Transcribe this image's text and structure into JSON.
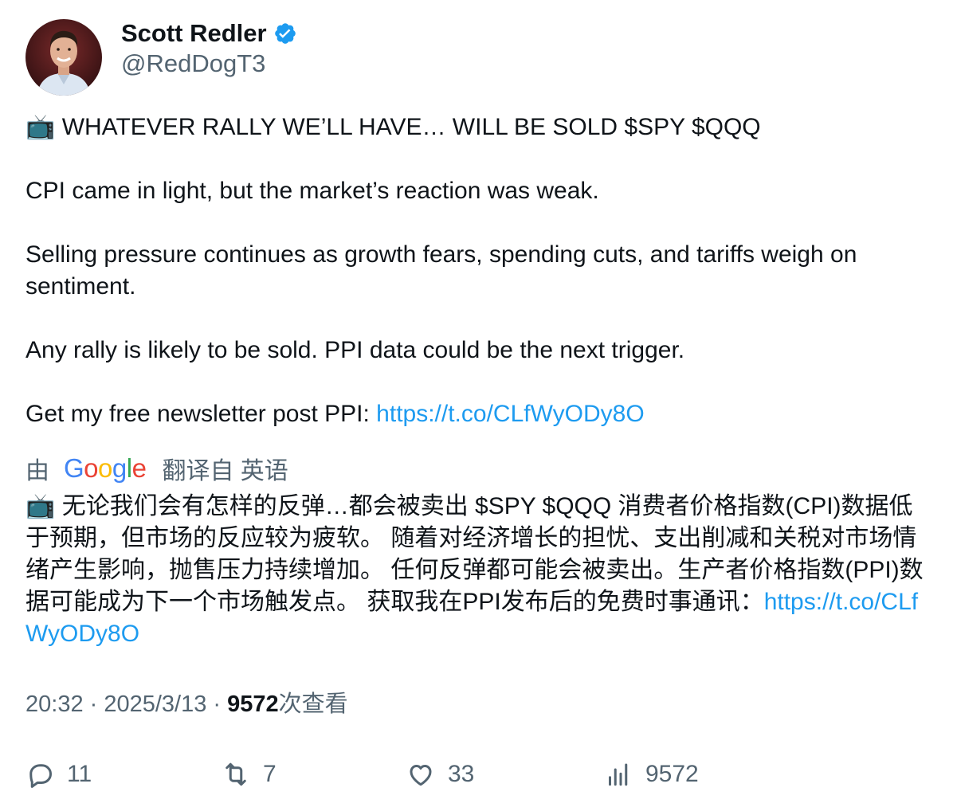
{
  "author": {
    "display_name": "Scott Redler",
    "handle": "@RedDogT3",
    "verified": true,
    "verified_color": "#1d9bf0"
  },
  "tweet": {
    "line1": "📺 WHATEVER RALLY WE’LL HAVE… WILL BE SOLD $SPY $QQQ",
    "line2": "CPI came in light, but the market’s reaction was weak.",
    "line3": "Selling pressure continues as growth fears, spending cuts, and tariffs weigh on sentiment.",
    "line4": "Any rally is likely to be sold. PPI data could be the next trigger.",
    "line5_prefix": "Get my free newsletter post PPI: ",
    "link": "https://t.co/CLfWyODy8O"
  },
  "translation": {
    "by_label": "由",
    "google_letters": [
      "G",
      "o",
      "o",
      "g",
      "l",
      "e"
    ],
    "translated_from": "翻译自 英语",
    "text": "📺 无论我们会有怎样的反弹…都会被卖出 $SPY $QQQ 消费者价格指数(CPI)数据低于预期，但市场的反应较为疲软。 随着对经济增长的担忧、支出削减和关税对市场情绪产生影响，抛售压力持续增加。 任何反弹都可能会被卖出。生产者价格指数(PPI)数据可能成为下一个市场触发点。 获取我在PPI发布后的免费时事通讯：",
    "link": "https://t.co/CLfWyODy8O"
  },
  "meta": {
    "time": "20:32",
    "separator": " · ",
    "date": "2025/3/13",
    "views_count": "9572",
    "views_label": "次查看"
  },
  "actions": {
    "replies": "11",
    "retweets": "7",
    "likes": "33",
    "views": "9572"
  },
  "colors": {
    "link": "#1d9bf0",
    "secondary_text": "#536471",
    "primary_text": "#0f1419"
  }
}
